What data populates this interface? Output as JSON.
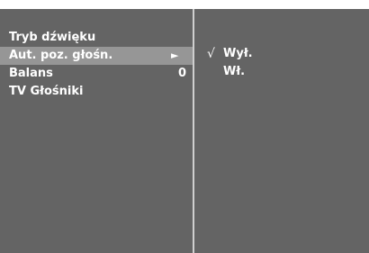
{
  "menu": {
    "items": [
      {
        "label": "Tryb dźwięku",
        "value": "",
        "arrow": ""
      },
      {
        "label": "Aut. poz. głośn.",
        "value": "",
        "arrow": "►"
      },
      {
        "label": "Balans",
        "value": "0",
        "arrow": ""
      },
      {
        "label": "TV Głośniki",
        "value": "",
        "arrow": ""
      }
    ],
    "selected_index": 1
  },
  "submenu": {
    "options": [
      {
        "label": "Wył.",
        "checked": true,
        "check_mark": "√"
      },
      {
        "label": "Wł.",
        "checked": false,
        "check_mark": ""
      }
    ]
  },
  "colors": {
    "panel": "#646464",
    "highlight": "#969696",
    "divider": "#cfcfcf",
    "text": "#ffffff"
  }
}
